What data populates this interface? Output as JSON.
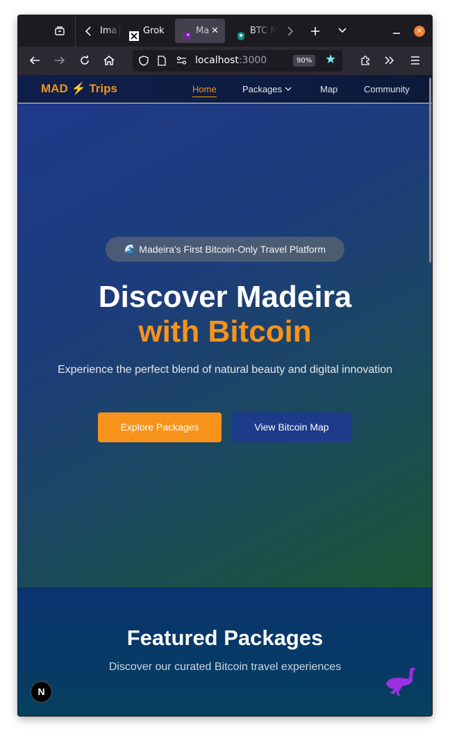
{
  "browser": {
    "tabs": [
      {
        "title": "Ima",
        "active": false
      },
      {
        "title": "Grok",
        "active": false
      },
      {
        "title": "Ma",
        "active": true
      },
      {
        "title": "BTC M",
        "active": false
      }
    ],
    "url_host": "localhost",
    "url_port": ":3000",
    "zoom": "90%",
    "icons": {
      "tab_overview": "tab-overview-icon",
      "back": "arrow-left-icon",
      "forward": "arrow-right-icon",
      "reload": "reload-icon",
      "home": "home-icon",
      "shield": "shield-icon",
      "page": "page-icon",
      "permissions": "permissions-icon",
      "bookmark": "star-icon",
      "extensions": "puzzle-icon",
      "overflow": "chevrons-right-icon",
      "menu": "hamburger-icon",
      "new_tab": "plus-icon",
      "list_tabs": "chevron-down-icon",
      "minimize": "minimize-icon",
      "close": "close-icon"
    },
    "colors": {
      "bookmark_star": "#80ebff",
      "close": "#f07f36"
    }
  },
  "site": {
    "logo_text": "MAD",
    "logo_bolt": "⚡",
    "logo_suffix": "Trips",
    "nav": [
      {
        "label": "Home",
        "active": true
      },
      {
        "label": "Packages",
        "dropdown": true
      },
      {
        "label": "Map"
      },
      {
        "label": "Community"
      }
    ],
    "hero": {
      "badge_emoji": "🌊",
      "badge_text": "Madeira's First Bitcoin-Only Travel Platform",
      "title_line1": "Discover Madeira",
      "title_line2": "with Bitcoin",
      "subtitle": "Experience the perfect blend of natural beauty and digital innovation",
      "primary_button": "Explore Packages",
      "secondary_button": "View Bitcoin Map"
    },
    "featured": {
      "heading": "Featured Packages",
      "subheading": "Discover our curated Bitcoin travel experiences"
    },
    "dev_badge": "N",
    "colors": {
      "accent": "#f7931a",
      "navy": "#1e3a8a",
      "mascot": "#9b30e0"
    }
  }
}
